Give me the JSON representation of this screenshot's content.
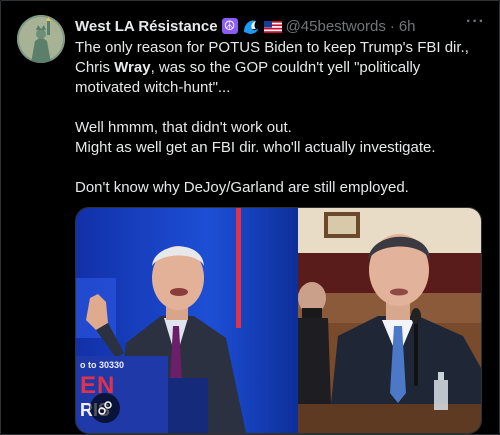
{
  "tweet": {
    "display_name": "West LA Résistance",
    "emojis": [
      "peace-icon",
      "wave-icon",
      "us-flag-icon"
    ],
    "handle": "@45bestwords",
    "separator": "·",
    "time": "6h",
    "more": "···",
    "text_lines": {
      "p1_a": "The only reason for POTUS Biden to keep Trump's FBI dir.,",
      "p1_b_pre": "Chris ",
      "p1_b_bold": "Wray",
      "p1_b_post": ", was so the GOP couldn't yell \"politically",
      "p1_c": "motivated witch-hunt\"...",
      "p2_a": "Well hmmm, that didn't work out.",
      "p2_b": "Might as well get an FBI dir. who'll actually investigate.",
      "p3": "Don't know why DeJoy/Garland are still employed."
    },
    "media": {
      "left_sign_number": "o to 30330",
      "left_sign_word1": "EN",
      "left_sign_word2": "RIS",
      "colors": {
        "sign_blue": "#1f3aa8",
        "sign_red": "#e0334b",
        "bg_blue": "#1a44d0"
      }
    }
  }
}
